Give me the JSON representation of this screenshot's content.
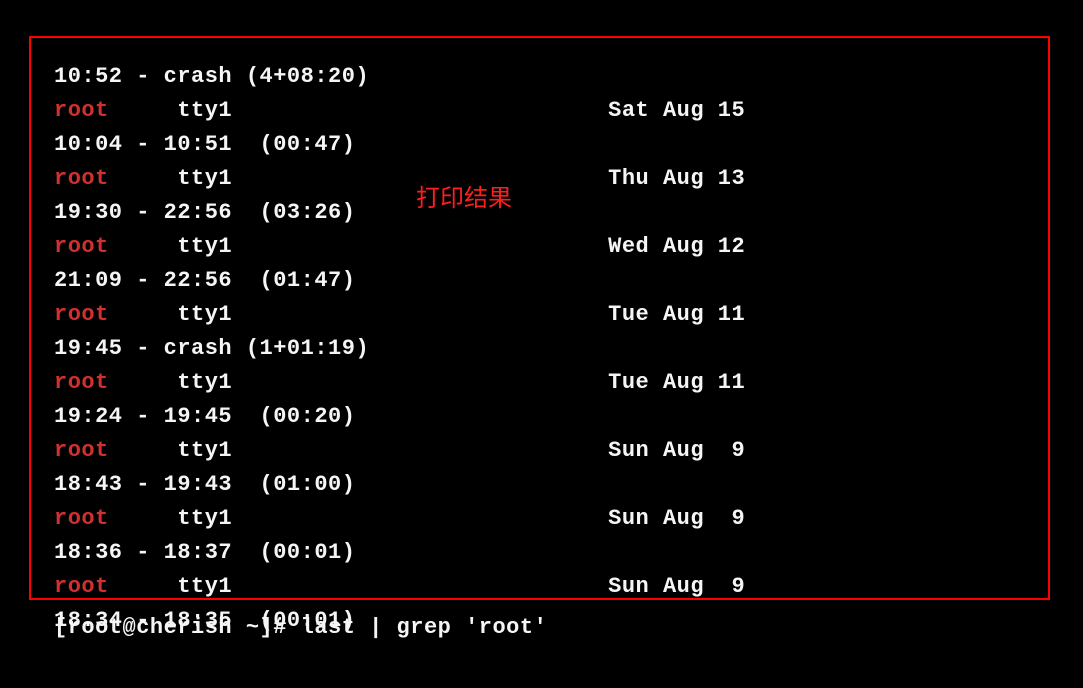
{
  "annotation": "打印结果",
  "prompt": "[root@cherish ~]# last | grep 'root'",
  "lines": [
    {
      "type": "time",
      "text": "10:52 - crash (4+08:20)"
    },
    {
      "type": "login",
      "user": "root",
      "tty": "tty1",
      "date": "Sat Aug 15"
    },
    {
      "type": "time",
      "text": "10:04 - 10:51  (00:47)"
    },
    {
      "type": "login",
      "user": "root",
      "tty": "tty1",
      "date": "Thu Aug 13"
    },
    {
      "type": "time",
      "text": "19:30 - 22:56  (03:26)"
    },
    {
      "type": "login",
      "user": "root",
      "tty": "tty1",
      "date": "Wed Aug 12"
    },
    {
      "type": "time",
      "text": "21:09 - 22:56  (01:47)"
    },
    {
      "type": "login",
      "user": "root",
      "tty": "tty1",
      "date": "Tue Aug 11"
    },
    {
      "type": "time",
      "text": "19:45 - crash (1+01:19)"
    },
    {
      "type": "login",
      "user": "root",
      "tty": "tty1",
      "date": "Tue Aug 11"
    },
    {
      "type": "time",
      "text": "19:24 - 19:45  (00:20)"
    },
    {
      "type": "login",
      "user": "root",
      "tty": "tty1",
      "date": "Sun Aug  9"
    },
    {
      "type": "time",
      "text": "18:43 - 19:43  (01:00)"
    },
    {
      "type": "login",
      "user": "root",
      "tty": "tty1",
      "date": "Sun Aug  9"
    },
    {
      "type": "time",
      "text": "18:36 - 18:37  (00:01)"
    },
    {
      "type": "login",
      "user": "root",
      "tty": "tty1",
      "date": "Sun Aug  9"
    },
    {
      "type": "time",
      "text": "18:34 - 18:35  (00:01)"
    }
  ]
}
